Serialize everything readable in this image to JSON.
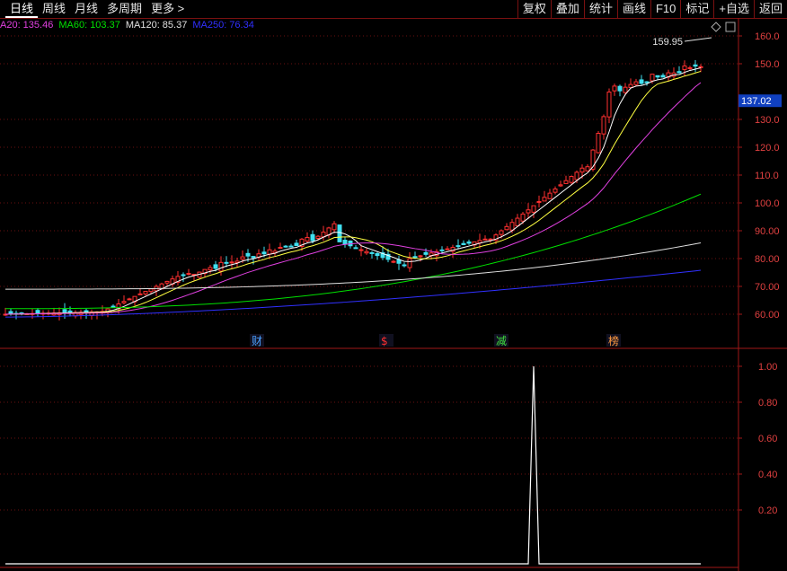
{
  "toolbar": {
    "periods": [
      {
        "label": "日线",
        "active": true
      },
      {
        "label": "周线",
        "active": false
      },
      {
        "label": "月线",
        "active": false
      },
      {
        "label": "多周期",
        "active": false
      },
      {
        "label": "更多 >",
        "active": false
      }
    ],
    "actions": [
      "复权",
      "叠加",
      "统计",
      "画线",
      "F10",
      "标记",
      "+自选",
      "返回"
    ]
  },
  "ma_legend": [
    {
      "label": "A20: 135.46",
      "color": "#e040e0"
    },
    {
      "label": "MA60: 103.37",
      "color": "#00e000"
    },
    {
      "label": "MA120: 85.37",
      "color": "#e0e0e0"
    },
    {
      "label": "MA250: 76.34",
      "color": "#3030ff"
    }
  ],
  "price_axis": {
    "ticks": [
      "160.0",
      "150.0",
      "130.0",
      "120.0",
      "110.0",
      "100.0",
      "90.00",
      "80.00",
      "70.00",
      "60.00"
    ],
    "current_price": "137.02",
    "high_label": "159.95"
  },
  "event_markers": [
    {
      "label": "财",
      "color": "#4aa0ff"
    },
    {
      "label": "$",
      "color": "#ff3030"
    },
    {
      "label": "减",
      "color": "#40e040"
    },
    {
      "label": "榜",
      "color": "#ff9a40"
    }
  ],
  "indicator_axis": {
    "ticks": [
      "1.00",
      "0.80",
      "0.60",
      "0.40",
      "0.20"
    ]
  },
  "chart_data": {
    "type": "line",
    "series": [
      {
        "name": "",
        "values": [
          0,
          0,
          0,
          0,
          0,
          0,
          0,
          0,
          0,
          0,
          0,
          0,
          0,
          0,
          0,
          0,
          0,
          0,
          0,
          0,
          0,
          0,
          0,
          0,
          0,
          0,
          0,
          0,
          0,
          0,
          0,
          0,
          0,
          0,
          0,
          0,
          0,
          0,
          0,
          0,
          0,
          0,
          0,
          0,
          0,
          0,
          0,
          0,
          0,
          0,
          0,
          0,
          0,
          0,
          0,
          0,
          0,
          0,
          0,
          0,
          0,
          0,
          0,
          0,
          0,
          0,
          0,
          0,
          0,
          0,
          0,
          0,
          0,
          0,
          0,
          0,
          0,
          0,
          0,
          0,
          0,
          0,
          0,
          0,
          0,
          0,
          0,
          0,
          0,
          0,
          0,
          0,
          0,
          0,
          0,
          0,
          0,
          0,
          1,
          0,
          0,
          0,
          0,
          0,
          0,
          0,
          0,
          0,
          0,
          0,
          0,
          0,
          0,
          0,
          0,
          0,
          0,
          0,
          0,
          0,
          0,
          0,
          0,
          0,
          0,
          0,
          0,
          0,
          0,
          0
        ]
      }
    ],
    "ylim": [
      0,
      1.0
    ]
  }
}
